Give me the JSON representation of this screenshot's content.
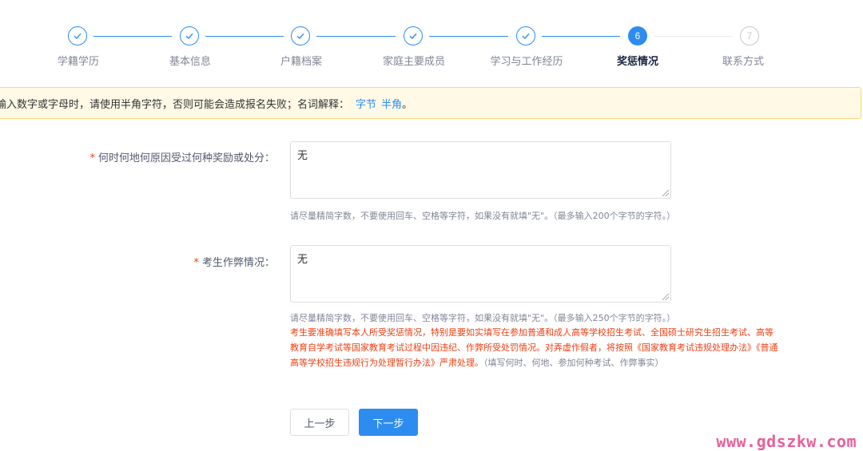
{
  "steps": [
    {
      "label": "学籍学历",
      "state": "done",
      "icon": "check-icon"
    },
    {
      "label": "基本信息",
      "state": "done",
      "icon": "check-icon"
    },
    {
      "label": "户籍档案",
      "state": "done",
      "icon": "check-icon"
    },
    {
      "label": "家庭主要成员",
      "state": "done",
      "icon": "check-icon"
    },
    {
      "label": "学习与工作经历",
      "state": "done",
      "icon": "check-icon"
    },
    {
      "label": "奖惩情况",
      "state": "active",
      "number": "6"
    },
    {
      "label": "联系方式",
      "state": "todo",
      "number": "7"
    }
  ],
  "notice": {
    "text": "输入数字或字母时，请使用半角字符，否则可能会造成报名失败；名词解释：",
    "link1": "字节",
    "link2": "半角",
    "end": "。"
  },
  "form": {
    "field1": {
      "required_mark": "*",
      "label": "何时何地何原因受过何种奖励或处分：",
      "value": "无",
      "hint": "请尽量精简字数，不要使用回车、空格等字符，如果没有就填\"无\"。（最多输入200个字节的字符。）"
    },
    "field2": {
      "required_mark": "*",
      "label": "考生作弊情况：",
      "value": "无",
      "hint": "请尽量精简字数，不要使用回车、空格等字符，如果没有就填\"无\"。（最多输入250个字节的字符。）",
      "warning": "考生要准确填写本人所受奖惩情况，特别是要如实填写在参加普通和成人高等学校招生考试、全国硕士研究生招生考试、高等教育自学考试等国家教育考试过程中因违纪、作弊所受处罚情况。对弄虚作假者，将按照《国家教育考试违规处理办法》《普通高等学校招生违规行为处理暂行办法》严肃处理。",
      "warning_note": "（填写何时、何地、参加何种考试、作弊事实）"
    }
  },
  "buttons": {
    "prev": "上一步",
    "next": "下一步"
  },
  "watermark": "www.gdszkw.com",
  "colors": {
    "primary": "#2d8cf0",
    "error": "#ed4014",
    "notice_bg": "#fff9e6",
    "watermark": "#e8609a"
  }
}
